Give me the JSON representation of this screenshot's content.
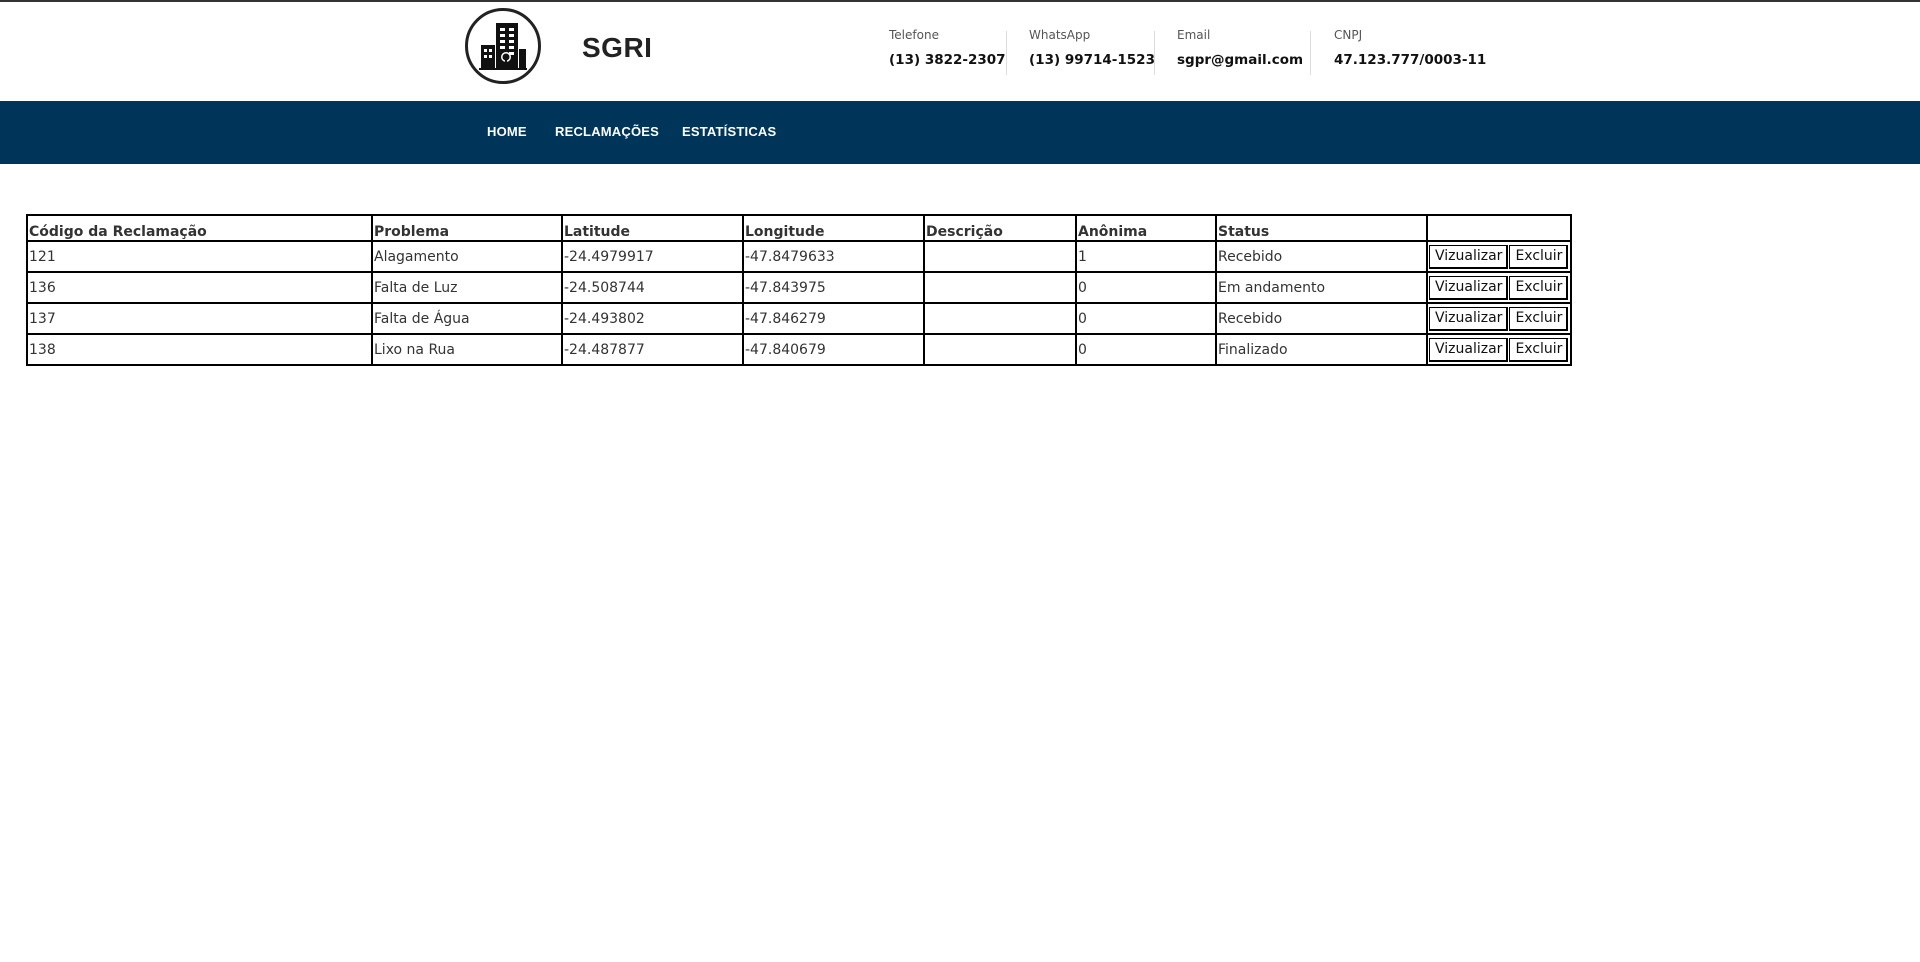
{
  "header": {
    "brand": "SGRI",
    "logo_icon": "building-icon",
    "contacts": [
      {
        "label": "Telefone",
        "value": "(13) 3822-2307"
      },
      {
        "label": "WhatsApp",
        "value": "(13) 99714-1523"
      },
      {
        "label": "Email",
        "value": "sgpr@gmail.com"
      },
      {
        "label": "CNPJ",
        "value": "47.123.777/0003-11"
      }
    ]
  },
  "nav": {
    "items": [
      {
        "label": "HOME"
      },
      {
        "label": "RECLAMAÇÕES"
      },
      {
        "label": "ESTATÍSTICAS"
      }
    ],
    "background": "#00355a"
  },
  "table": {
    "columns": [
      "Código da Reclamação",
      "Problema",
      "Latitude",
      "Longitude",
      "Descrição",
      "Anônima",
      "Status",
      ""
    ],
    "rows": [
      {
        "codigo": "121",
        "problema": "Alagamento",
        "latitude": "-24.4979917",
        "longitude": "-47.8479633",
        "descricao": "",
        "anonima": "1",
        "status": "Recebido"
      },
      {
        "codigo": "136",
        "problema": "Falta de Luz",
        "latitude": "-24.508744",
        "longitude": "-47.843975",
        "descricao": "",
        "anonima": "0",
        "status": "Em andamento"
      },
      {
        "codigo": "137",
        "problema": "Falta de Água",
        "latitude": "-24.493802",
        "longitude": "-47.846279",
        "descricao": "",
        "anonima": "0",
        "status": "Recebido"
      },
      {
        "codigo": "138",
        "problema": "Lixo na Rua",
        "latitude": "-24.487877",
        "longitude": "-47.840679",
        "descricao": "",
        "anonima": "0",
        "status": "Finalizado"
      }
    ],
    "view_label": "Vizualizar",
    "delete_label": "Excluir"
  }
}
